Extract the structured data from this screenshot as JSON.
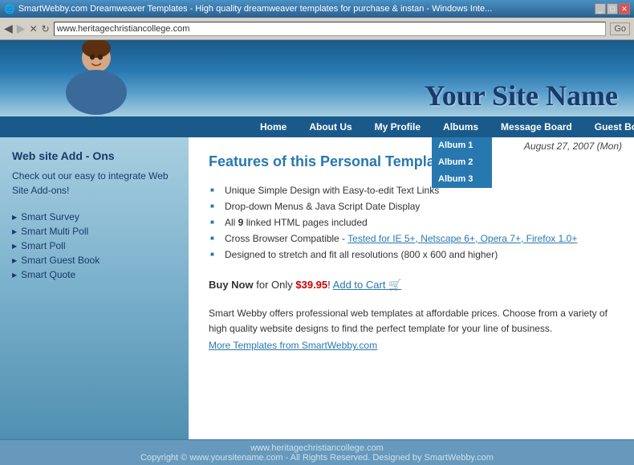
{
  "titlebar": {
    "title": "SmartWebby.com Dreamweaver Templates - High quality dreamweaver templates for purchase & instan - Windows Inte...",
    "controls": [
      "_",
      "□",
      "✕"
    ]
  },
  "address": {
    "url": "www.heritagechristiancollege.com"
  },
  "header": {
    "site_name": "Your Site Name"
  },
  "nav": {
    "items": [
      {
        "label": "Home",
        "id": "home"
      },
      {
        "label": "About Us",
        "id": "about-us"
      },
      {
        "label": "My Profile",
        "id": "my-profile"
      },
      {
        "label": "Albums",
        "id": "albums",
        "has_dropdown": true
      },
      {
        "label": "Message Board",
        "id": "message-board"
      },
      {
        "label": "Guest Book",
        "id": "guest-book"
      }
    ],
    "albums_submenu": [
      {
        "label": "Album 1"
      },
      {
        "label": "Album 2"
      },
      {
        "label": "Album 3"
      }
    ]
  },
  "date": "August 27, 2007 (Mon)",
  "sidebar": {
    "title": "Web site Add - Ons",
    "description": "Check out our easy to integrate Web Site Add-ons!",
    "links": [
      "Smart Survey",
      "Smart Multi Poll",
      "Smart Poll",
      "Smart Guest Book",
      "Smart Quote"
    ]
  },
  "content": {
    "title": "Features of this Personal Template",
    "features": [
      "Unique Simple Design with Easy-to-edit Text Links",
      "Drop-down Menus & Java Script Date Display",
      "All 9 linked HTML pages included",
      "Cross Browser Compatible - Tested for IE 5+, Netscape 6+, Opera 7+, Firefox 1.0+",
      "Designed to stretch and fit all resolutions (800 x 600 and higher)"
    ],
    "feature_bold_index": 2,
    "feature_bold_word": "9",
    "buy_text_prefix": "Buy Now",
    "buy_text_middle": " for Only ",
    "price": "$39.95",
    "buy_text_suffix": "!",
    "add_to_cart": "Add to Cart",
    "description": "Smart Webby offers professional web templates at affordable prices. Choose from a variety of high quality website designs to find the perfect template for your line of business.",
    "more_templates_link": "More Templates from SmartWebby.com"
  },
  "footer": {
    "url": "www.heritagechristiancollege.com",
    "copyright": "Copyright © www.yoursitename.com - All Rights Reserved. Designed by SmartWebby.com"
  }
}
